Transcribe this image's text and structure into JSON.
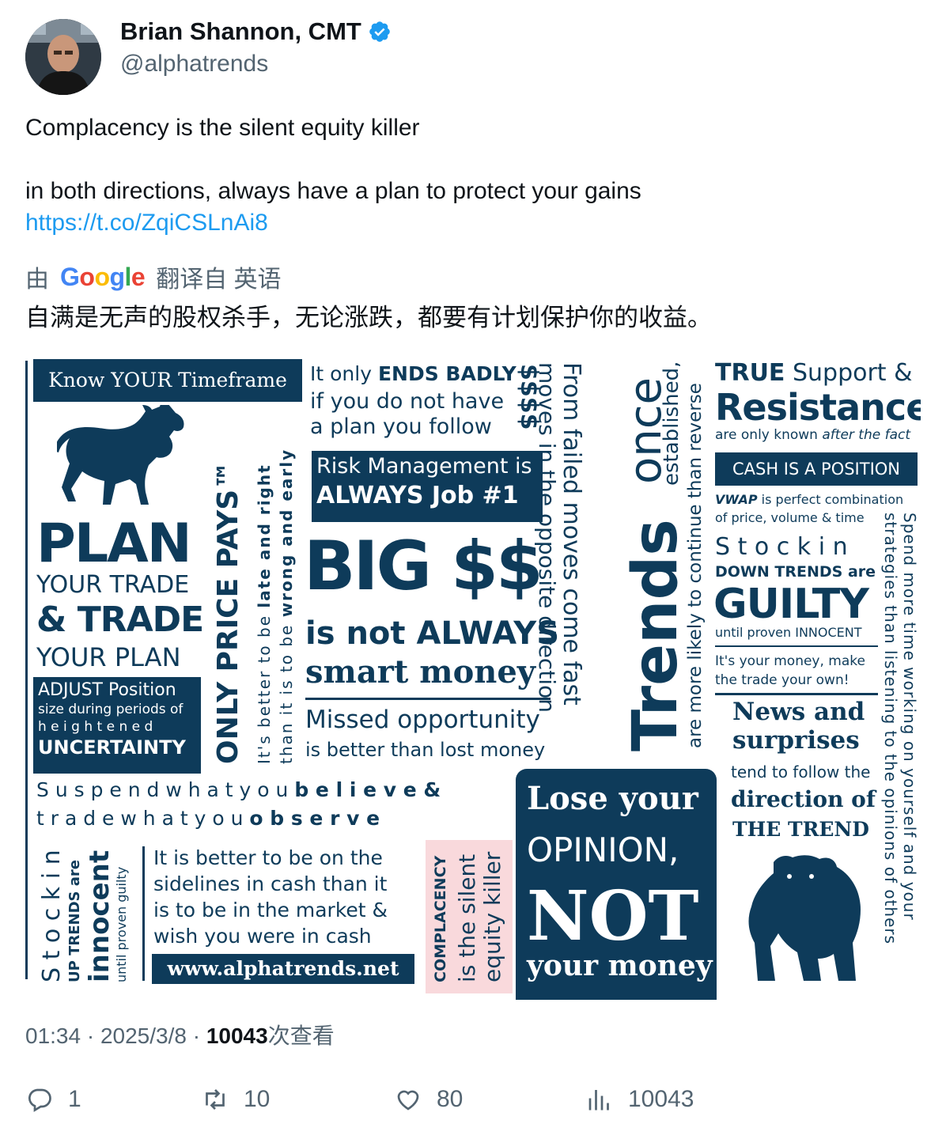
{
  "author": {
    "display_name": "Brian Shannon, CMT",
    "handle": "@alphatrends",
    "verified": true
  },
  "tweet": {
    "line1": "Complacency is the silent equity killer",
    "line2": "in both directions, always have a plan to protect your gains",
    "link": "https://t.co/ZqiCSLnAi8"
  },
  "translation": {
    "prefix": "由",
    "provider": "Google",
    "suffix": "翻译自 英语",
    "text": "自满是无声的股权杀手，无论涨跌，都要有计划保护你的收益。"
  },
  "poster": {
    "know_timeframe": "Know YOUR Timeframe",
    "plan": "PLAN",
    "your_trade": "YOUR TRADE",
    "and_trade": "& TRADE",
    "your_plan": "YOUR PLAN",
    "adjust1": "ADJUST Position",
    "adjust2": "size during periods of",
    "adjust3": "h e i g h t e n e d",
    "adjust4": "UNCERTAINTY",
    "only_price_pays": "ONLY PRICE PAYS™",
    "late_right_a": "It's better to be",
    "late_right_b": "late and right",
    "wrong_early_a": "than it is to be",
    "wrong_early_b": "wrong and early",
    "ends_badly1a": "It only",
    "ends_badly1b": "ENDS BADLY",
    "ends_badly2": "if you do not have",
    "ends_badly3": "a plan you follow",
    "dollars_vertical": "$$$$",
    "risk1": "Risk Management is",
    "risk2": "ALWAYS Job #1",
    "big_ss": "BIG $$",
    "not_always": "is not ALWAYS",
    "smart_money": "smart money",
    "missed1": "Missed opportunity",
    "missed2": "is better than lost money",
    "failed_moves": "From failed moves come fast",
    "opposite": "moves in the opposite direction",
    "trends_once": "Trends",
    "once": "once",
    "established": "established,",
    "continue": "are more likely to continue than reverse",
    "true_sr1a": "TRUE",
    "true_sr1b": "Support &",
    "resistance": "Resistance",
    "after_fact_a": "are only known",
    "after_fact_b": "after the fact",
    "cash_position": "CASH IS A POSITION",
    "vwap1a": "VWAP",
    "vwap1b": "is perfect combination",
    "vwap2": "of price, volume & time",
    "stock_in": "S t o c k   i n",
    "down_trends": "DOWN TRENDS are",
    "guilty": "GUILTY",
    "until_innocent": "until proven INNOCENT",
    "your_money1": "It's your money, make",
    "your_money2": "the trade your own!",
    "news1": "News and",
    "news2": "surprises",
    "news3": "tend to follow the",
    "news4": "direction of",
    "news5": "THE TREND",
    "spend_time1": "Spend more time working on yourself and your",
    "spend_time2": "strategies than listening to the opinions of others",
    "suspend1a": "S u s p e n d   w h a t   y o u",
    "suspend1b": "b e l i e v e   &",
    "suspend2a": "t r a d e   w h a t   y o u",
    "suspend2b": "o b s e r v e",
    "stock_in_up": "S t o c k   i n",
    "up_trends": "UP TRENDS are",
    "innocent": "innocent",
    "until_guilty": "until proven guilty",
    "sidelines1": "It is better to be on the",
    "sidelines2": "sidelines in cash than it",
    "sidelines3": "is to be in the market &",
    "sidelines4": "wish you were in cash",
    "website": "www.alphatrends.net",
    "complacency1": "COMPLACENCY",
    "complacency2": "is the silent",
    "complacency3": "equity killer",
    "lose1": "Lose your",
    "lose2": "OPINION,",
    "lose3": "NOT",
    "lose4": "your money"
  },
  "meta": {
    "time": "01:34 · 2025/3/8 · ",
    "views_count": "10043",
    "views_label": "次查看"
  },
  "actions": {
    "replies": "1",
    "reposts": "10",
    "likes": "80",
    "views": "10043"
  },
  "colors": {
    "navy": "#0e3b5a",
    "link": "#1d9bf0",
    "muted": "#536471",
    "pink": "#f9d9dc"
  }
}
